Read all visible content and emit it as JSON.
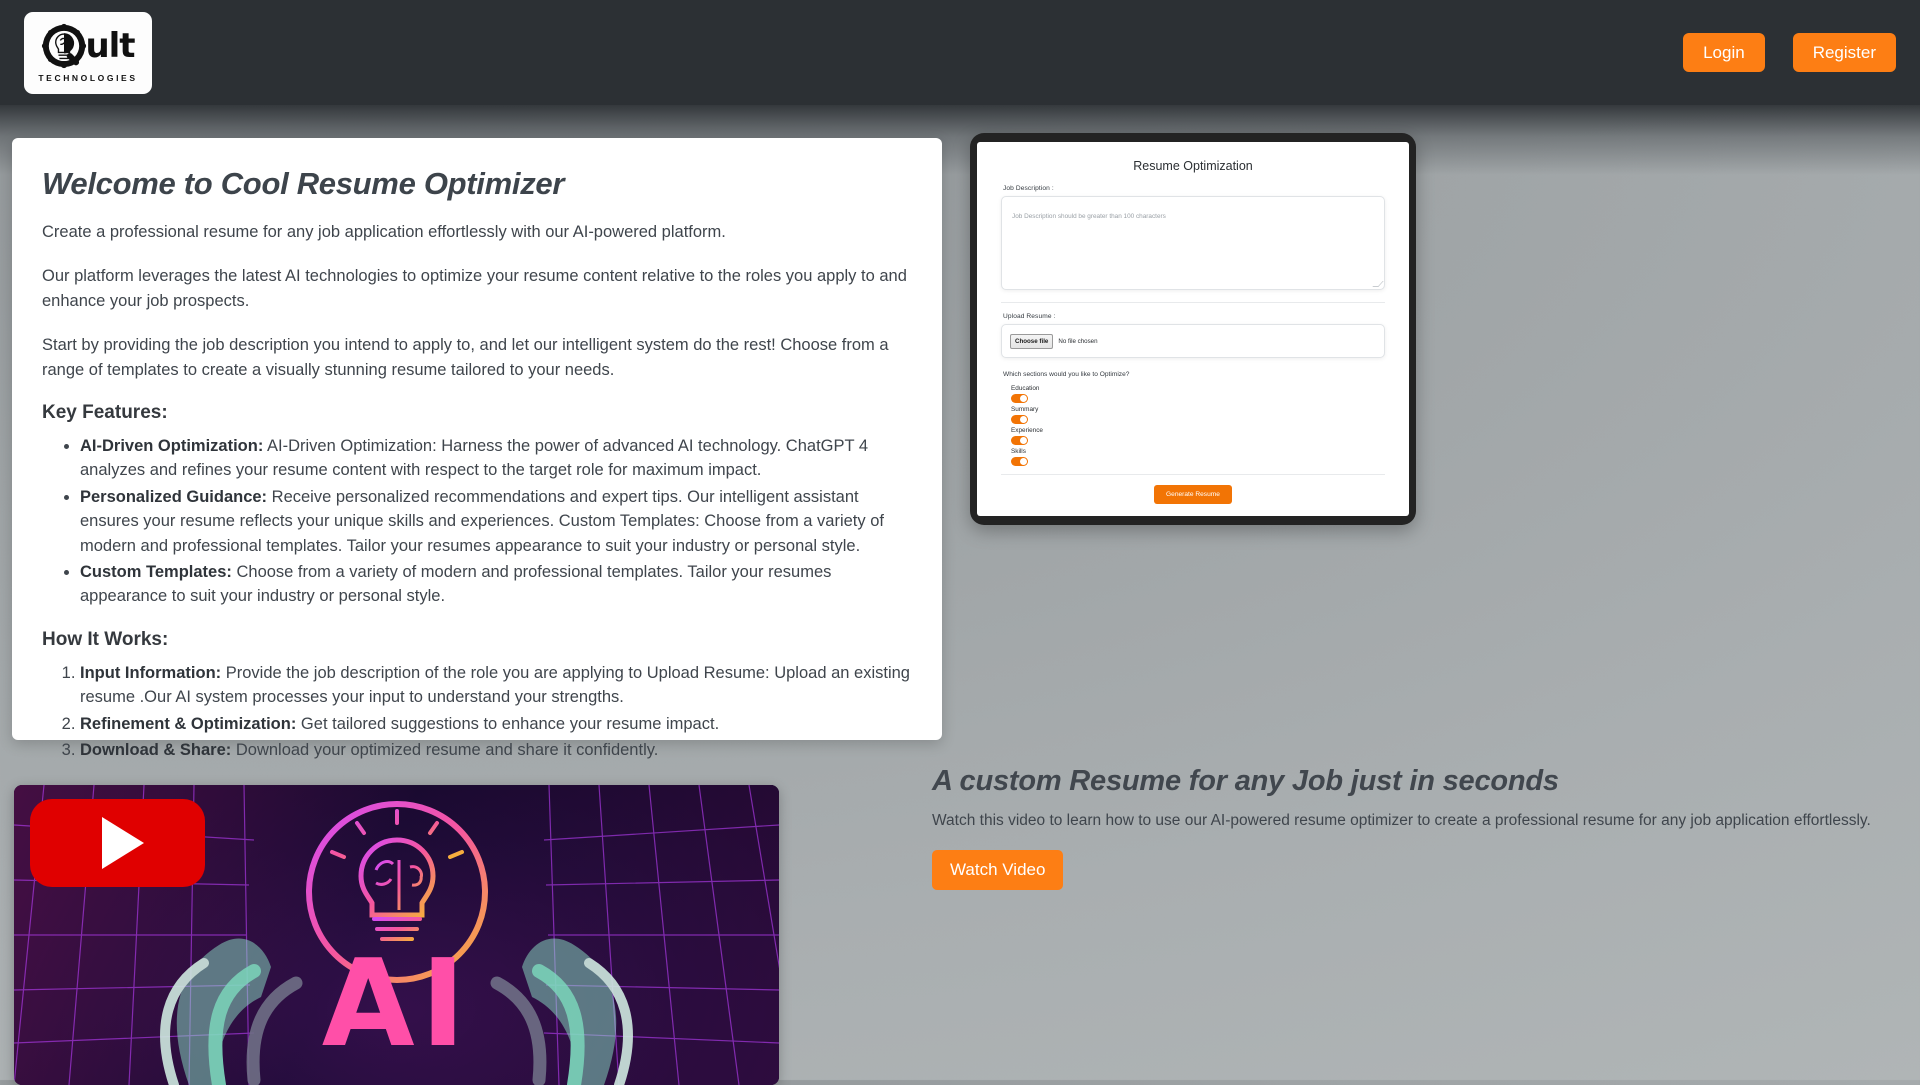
{
  "header": {
    "logo": {
      "word": "ult",
      "tagline": "TECHNOLOGIES",
      "icon": "qult-brain-bulb-logo"
    },
    "login_label": "Login",
    "register_label": "Register",
    "background_color": "#2c3034",
    "accent_color": "#fd7e14"
  },
  "intro": {
    "title": "Welcome to Cool Resume Optimizer",
    "paragraphs": [
      "Create a professional resume for any job application effortlessly with our AI-powered platform.",
      "Our platform leverages the latest AI technologies to optimize your resume content relative to the roles you apply to and enhance your job prospects.",
      "Start by providing the job description you intend to apply to, and let our intelligent system do the rest! Choose from a range of templates to create a visually stunning resume tailored to your needs."
    ],
    "features_heading": "Key Features:",
    "features": [
      {
        "term": "AI-Driven Optimization:",
        "desc": " AI-Driven Optimization: Harness the power of advanced AI technology. ChatGPT 4 analyzes and refines your resume content with respect to the target role for maximum impact."
      },
      {
        "term": "Personalized Guidance:",
        "desc": " Receive personalized recommendations and expert tips. Our intelligent assistant ensures your resume reflects your unique skills and experiences. Custom Templates: Choose from a variety of modern and professional templates. Tailor your resumes appearance to suit your industry or personal style."
      },
      {
        "term": "Custom Templates:",
        "desc": " Choose from a variety of modern and professional templates. Tailor your resumes appearance to suit your industry or personal style."
      }
    ],
    "how_heading": "How It Works:",
    "steps": [
      {
        "term": "Input Information:",
        "desc": " Provide the job description of the role you are applying to Upload Resume: Upload an existing resume .Our AI system processes your input to understand your strengths."
      },
      {
        "term": "Refinement & Optimization:",
        "desc": " Get tailored suggestions to enhance your resume impact."
      },
      {
        "term": "Download & Share:",
        "desc": " Download your optimized resume and share it confidently."
      }
    ]
  },
  "mockup": {
    "title": "Resume Optimization",
    "job_description_label": "Job Description :",
    "job_description_placeholder": "Job Description should be greater than 100 characters",
    "upload_resume_label": "Upload Resume :",
    "file_button_label": "Choose file",
    "file_status": "No file chosen",
    "sections_question": "Which sections would you like to Optimize?",
    "sections": [
      {
        "label": "Education",
        "enabled": true
      },
      {
        "label": "Summary",
        "enabled": true
      },
      {
        "label": "Experience",
        "enabled": true
      },
      {
        "label": "Skills",
        "enabled": true
      }
    ],
    "generate_label": "Generate Resume",
    "toggle_color": "#f27405"
  },
  "video": {
    "thumbnail_text": "AI",
    "play_icon": "youtube-play-icon"
  },
  "promo": {
    "title": "A custom Resume for any Job just in seconds",
    "description": "Watch this video to learn how to use our AI-powered resume optimizer to create a professional resume for any job application effortlessly.",
    "button_label": "Watch Video"
  }
}
